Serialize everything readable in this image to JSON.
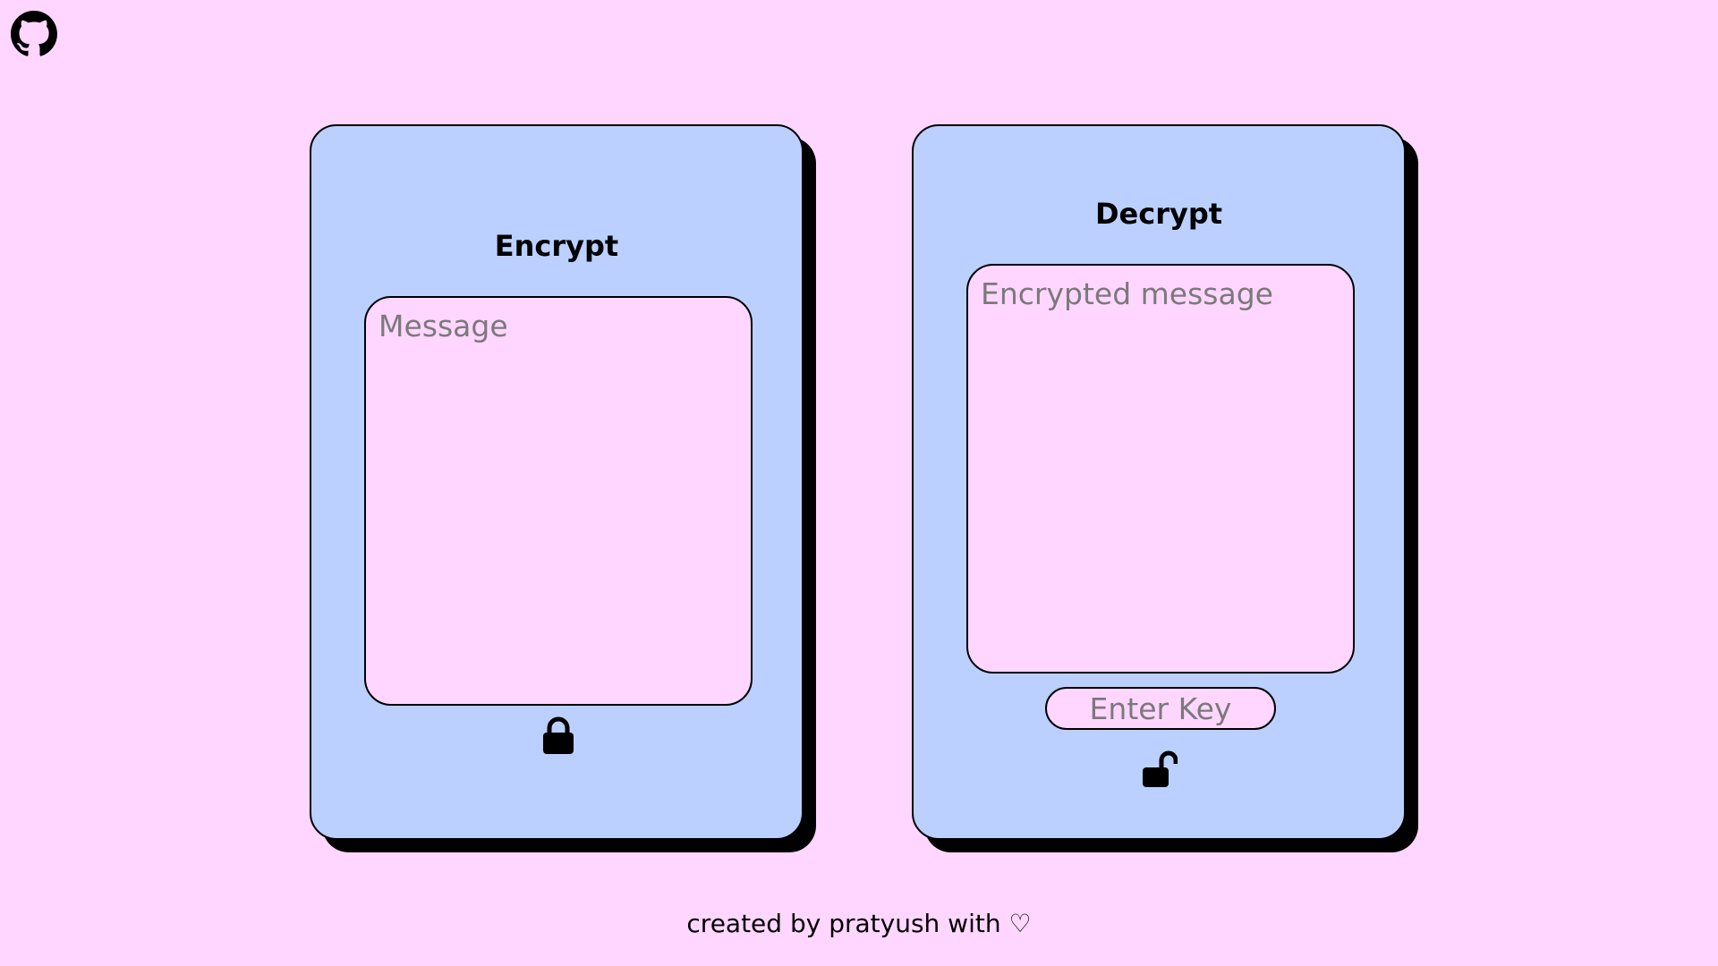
{
  "github": {
    "icon": "github-icon"
  },
  "encrypt": {
    "title": "Encrypt",
    "message_placeholder": "Message",
    "message_value": "",
    "action_icon": "lock-icon"
  },
  "decrypt": {
    "title": "Decrypt",
    "message_placeholder": "Encrypted message",
    "message_value": "",
    "key_placeholder": "Enter Key",
    "key_value": "",
    "action_icon": "unlock-icon"
  },
  "footer": {
    "text": "created by pratyush with ♡"
  },
  "colors": {
    "page_background": "#ffd6ff",
    "card_background": "#bbd0ff",
    "field_background": "#ffd6ff",
    "outline": "#000000",
    "placeholder": "#7a7a7a"
  }
}
